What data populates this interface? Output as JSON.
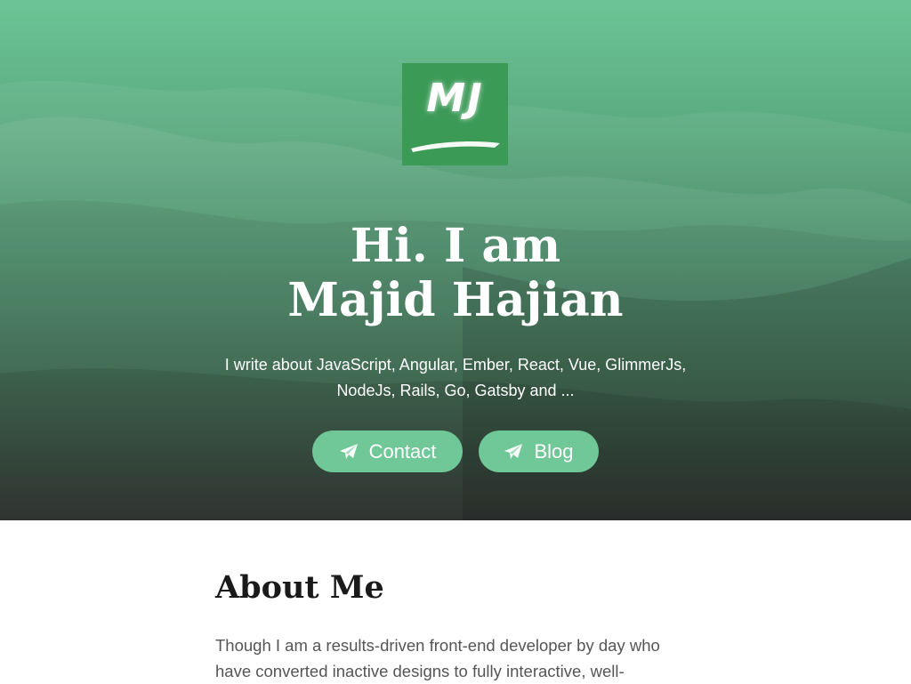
{
  "hero": {
    "logo_text": "MJ",
    "title_line1": "Hi. I am",
    "title_line2": "Majid Hajian",
    "subtitle": "I write about JavaScript, Angular, Ember, React, Vue, GlimmerJs, NodeJs, Rails, Go, Gatsby and ...",
    "buttons": [
      {
        "label": "Contact",
        "icon": "paper-plane-icon"
      },
      {
        "label": "Blog",
        "icon": "paper-plane-icon"
      }
    ]
  },
  "about": {
    "heading": "About Me",
    "text": "Though I am a results-driven front-end developer by day who have converted inactive designs to fully interactive, well-"
  },
  "colors": {
    "accent": "#70c797",
    "logo_bg": "#3c9a57",
    "hero_top": "#6cc596",
    "hero_bottom": "#1e2320",
    "heading": "#1a1a1a",
    "body_text": "#555555"
  }
}
